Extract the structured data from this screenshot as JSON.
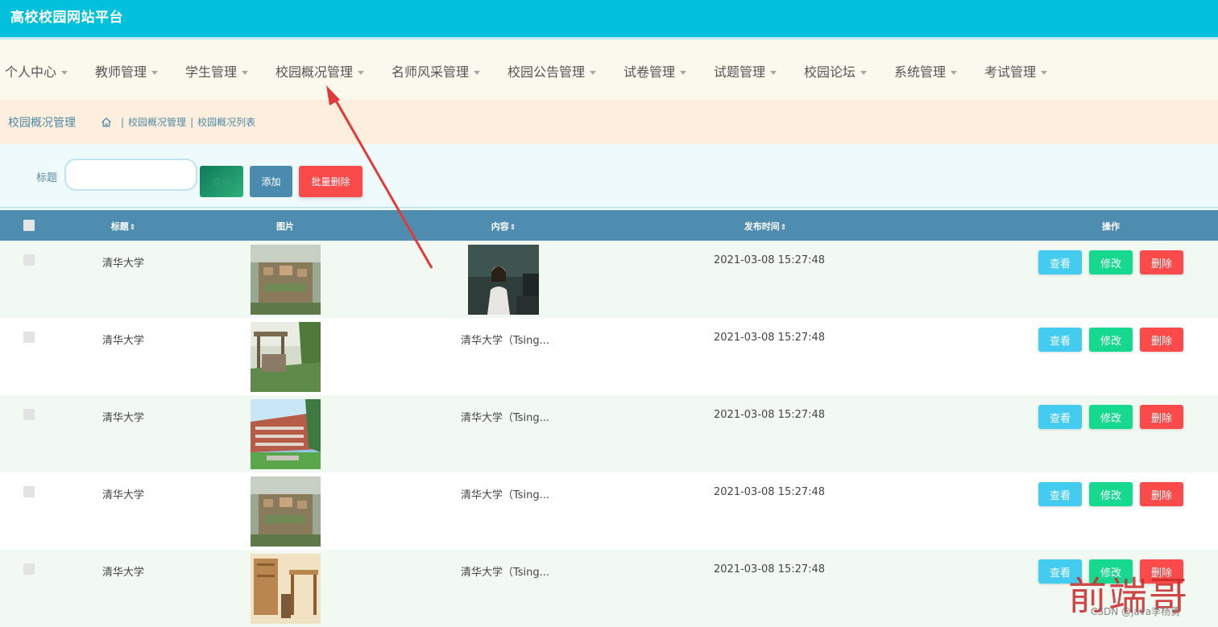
{
  "app": {
    "title": "高校校园网站平台"
  },
  "nav": {
    "items": [
      {
        "label": "个人中心"
      },
      {
        "label": "教师管理"
      },
      {
        "label": "学生管理"
      },
      {
        "label": "校园概况管理"
      },
      {
        "label": "名师风采管理"
      },
      {
        "label": "校园公告管理"
      },
      {
        "label": "试卷管理"
      },
      {
        "label": "试题管理"
      },
      {
        "label": "校园论坛"
      },
      {
        "label": "系统管理"
      },
      {
        "label": "考试管理"
      }
    ]
  },
  "breadcrumb": {
    "title": "校园概况管理",
    "path1": "校园概况管理",
    "path2": "校园概况列表",
    "separator": "|"
  },
  "search": {
    "label": "标题",
    "placeholder": "",
    "value": "",
    "query_label": "查询",
    "add_label": "添加",
    "batch_delete_label": "批量删除"
  },
  "table": {
    "columns": {
      "title": "标题",
      "image": "图片",
      "content": "内容",
      "time": "发布时间",
      "actions": "操作",
      "sort_glyph": "⇕"
    },
    "action_labels": {
      "view": "查看",
      "edit": "修改",
      "delete": "删除"
    },
    "rows": [
      {
        "title": "清华大学",
        "content": "",
        "time": "2021-03-08 15:27:48"
      },
      {
        "title": "清华大学",
        "content": "清华大学（Tsing...",
        "time": "2021-03-08 15:27:48"
      },
      {
        "title": "清华大学",
        "content": "清华大学（Tsing...",
        "time": "2021-03-08 15:27:48"
      },
      {
        "title": "清华大学",
        "content": "清华大学（Tsing...",
        "time": "2021-03-08 15:27:48"
      },
      {
        "title": "清华大学",
        "content": "清华大学（Tsing...",
        "time": "2021-03-08 15:27:48"
      }
    ]
  },
  "watermark": {
    "big": "前端哥",
    "small": "CSDN @java李杨勇"
  },
  "colors": {
    "topbar": "#00c0dc",
    "table_header": "#4e8db0",
    "view": "#43ccf0",
    "edit": "#17d88f",
    "delete": "#fb4a4a",
    "arrow": "#e03a3a"
  }
}
